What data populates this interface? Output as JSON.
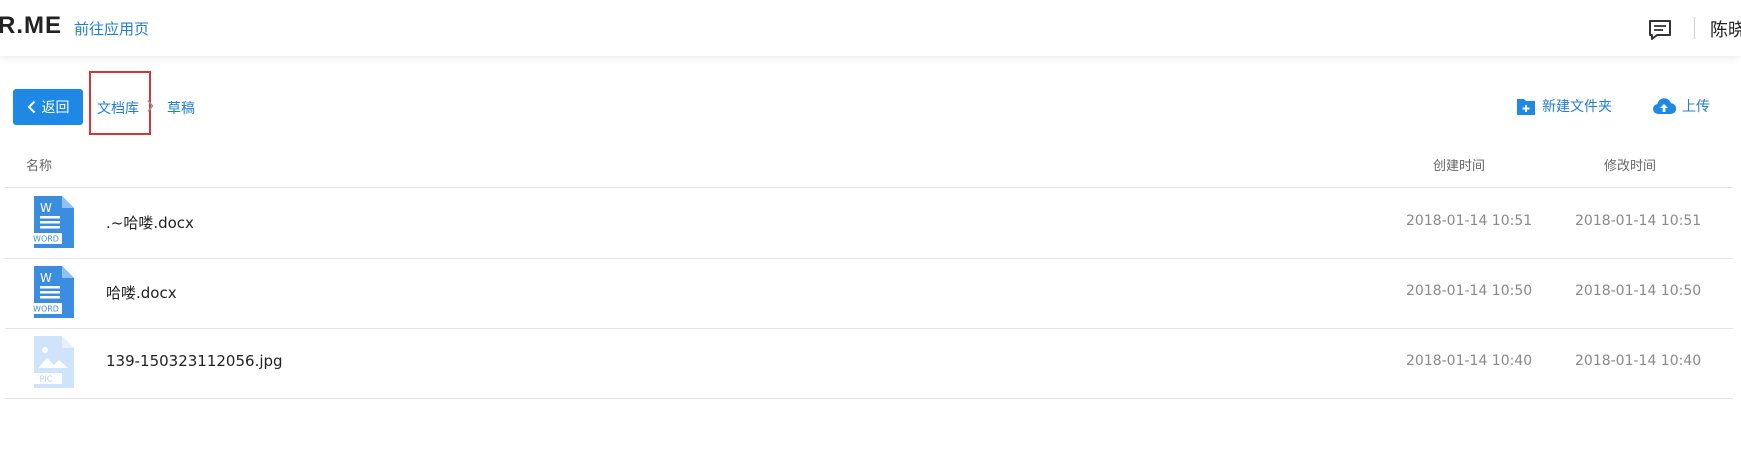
{
  "header": {
    "logo": "R.ME",
    "app_link": "前往应用页",
    "username": "陈晓"
  },
  "toolbar": {
    "back_label": "返回",
    "breadcrumb": [
      "文档库",
      "草稿"
    ],
    "new_folder_label": "新建文件夹",
    "upload_label": "上传"
  },
  "table": {
    "columns": {
      "name": "名称",
      "created": "创建时间",
      "modified": "修改时间"
    },
    "rows": [
      {
        "icon": "word-file-icon",
        "icon_text": "WORD",
        "name": ".~哈喽.docx",
        "created": "2018-01-14 10:51",
        "modified": "2018-01-14 10:51"
      },
      {
        "icon": "word-file-icon",
        "icon_text": "WORD",
        "name": "哈喽.docx",
        "created": "2018-01-14 10:50",
        "modified": "2018-01-14 10:50"
      },
      {
        "icon": "image-file-icon",
        "icon_text": "PIC",
        "name": "139-150323112056.jpg",
        "created": "2018-01-14 10:40",
        "modified": "2018-01-14 10:40"
      }
    ]
  },
  "colors": {
    "accent": "#1e88e5",
    "link": "#1f7fd6",
    "highlight_box": "#d9343a"
  }
}
